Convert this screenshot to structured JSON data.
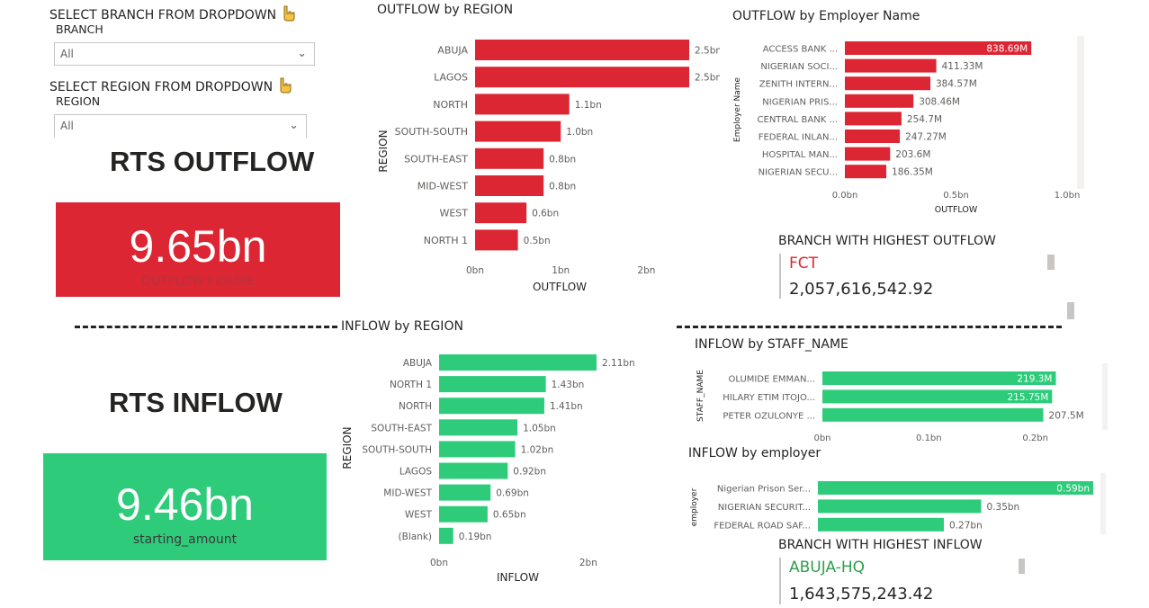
{
  "slicers": {
    "branch": {
      "title": "SELECT BRANCH FROM DROPDOWN",
      "label": "BRANCH",
      "value": "All",
      "icon": "pointing-hand-icon"
    },
    "region": {
      "title": "SELECT REGION FROM DROPDOWN",
      "label": "REGION",
      "value": "All",
      "icon": "pointing-hand-icon"
    }
  },
  "outflow_card": {
    "heading": "RTS OUTFLOW",
    "value": "9.65bn",
    "label": "OUTFLOW FIGURE",
    "color": "#dc2633",
    "label_color": "#c0333e"
  },
  "inflow_card": {
    "heading": "RTS INFLOW",
    "value": "9.46bn",
    "label": "starting_amount",
    "color": "#2ecc7a",
    "label_color": "#3a3a3a"
  },
  "branch_outflow": {
    "title": "BRANCH WITH HIGHEST OUTFLOW",
    "name": "FCT",
    "amount": "2,057,616,542.92",
    "name_color": "#dc2633"
  },
  "branch_inflow": {
    "title": "BRANCH WITH HIGHEST INFLOW",
    "name": "ABUJA-HQ",
    "amount": "1,643,575,243.42",
    "name_color": "#2e9e4f"
  },
  "chart_data": [
    {
      "id": "outflow_region",
      "type": "bar",
      "orientation": "horizontal",
      "title": "OUTFLOW by REGION",
      "xlabel": "OUTFLOW",
      "ylabel": "REGION",
      "color": "#dc2633",
      "categories": [
        "ABUJA",
        "LAGOS",
        "NORTH",
        "SOUTH-SOUTH",
        "SOUTH-EAST",
        "MID-WEST",
        "WEST",
        "NORTH 1"
      ],
      "values": [
        2.5,
        2.5,
        1.1,
        1.0,
        0.8,
        0.8,
        0.6,
        0.5
      ],
      "labels": [
        "2.5bn",
        "2.5bn",
        "1.1bn",
        "1.0bn",
        "0.8bn",
        "0.8bn",
        "0.6bn",
        "0.5bn"
      ],
      "xlim": [
        0,
        2.5
      ],
      "ticks": [
        0,
        1,
        2
      ],
      "tick_labels": [
        "0bn",
        "1bn",
        "2bn"
      ]
    },
    {
      "id": "outflow_employer",
      "type": "bar",
      "orientation": "horizontal",
      "title": "OUTFLOW by Employer Name",
      "xlabel": "OUTFLOW",
      "ylabel": "Employer Name",
      "color": "#dc2633",
      "categories": [
        "ACCESS BANK ...",
        "NIGERIAN SOCI...",
        "ZENITH INTERN...",
        "NIGERIAN PRIS...",
        "CENTRAL BANK ...",
        "FEDERAL INLAN...",
        "HOSPITAL MAN...",
        "NIGERIAN SECU..."
      ],
      "values": [
        0.83869,
        0.41133,
        0.38457,
        0.30846,
        0.2547,
        0.24727,
        0.2036,
        0.18635
      ],
      "labels": [
        "838.69M",
        "411.33M",
        "384.57M",
        "308.46M",
        "254.7M",
        "247.27M",
        "203.6M",
        "186.35M"
      ],
      "xlim": [
        0,
        1.0
      ],
      "ticks": [
        0,
        0.5,
        1.0
      ],
      "tick_labels": [
        "0.0bn",
        "0.5bn",
        "1.0bn"
      ]
    },
    {
      "id": "inflow_region",
      "type": "bar",
      "orientation": "horizontal",
      "title": "INFLOW by REGION",
      "xlabel": "INFLOW",
      "ylabel": "REGION",
      "color": "#2ecc7a",
      "categories": [
        "ABUJA",
        "NORTH 1",
        "NORTH",
        "SOUTH-EAST",
        "SOUTH-SOUTH",
        "LAGOS",
        "MID-WEST",
        "WEST",
        "(Blank)"
      ],
      "values": [
        2.11,
        1.43,
        1.41,
        1.05,
        1.02,
        0.92,
        0.69,
        0.65,
        0.19
      ],
      "labels": [
        "2.11bn",
        "1.43bn",
        "1.41bn",
        "1.05bn",
        "1.02bn",
        "0.92bn",
        "0.69bn",
        "0.65bn",
        "0.19bn"
      ],
      "xlim": [
        0,
        2.11
      ],
      "ticks": [
        0,
        2
      ],
      "tick_labels": [
        "0bn",
        "2bn"
      ]
    },
    {
      "id": "inflow_staff",
      "type": "bar",
      "orientation": "horizontal",
      "title": "INFLOW by STAFF_NAME",
      "xlabel": "",
      "ylabel": "STAFF_NAME",
      "color": "#2ecc7a",
      "categories": [
        "OLUMIDE EMMAN...",
        "HILARY ETIM ITOJO...",
        "PETER OZULONYE ..."
      ],
      "values": [
        0.2193,
        0.21575,
        0.2075
      ],
      "labels": [
        "219.3M",
        "215.75M",
        "207.5M"
      ],
      "xlim": [
        0,
        0.24
      ],
      "ticks": [
        0,
        0.1,
        0.2
      ],
      "tick_labels": [
        "0bn",
        "0.1bn",
        "0.2bn"
      ]
    },
    {
      "id": "inflow_employer",
      "type": "bar",
      "orientation": "horizontal",
      "title": "INFLOW by employer",
      "xlabel": "",
      "ylabel": "employer",
      "color": "#2ecc7a",
      "categories": [
        "Nigerian Prison Ser...",
        "NIGERIAN SECURIT...",
        "FEDERAL ROAD SAF..."
      ],
      "values": [
        0.59,
        0.35,
        0.27
      ],
      "labels": [
        "0.59bn",
        "0.35bn",
        "0.27bn"
      ],
      "xlim": [
        0,
        0.59
      ],
      "ticks": [],
      "tick_labels": []
    }
  ]
}
